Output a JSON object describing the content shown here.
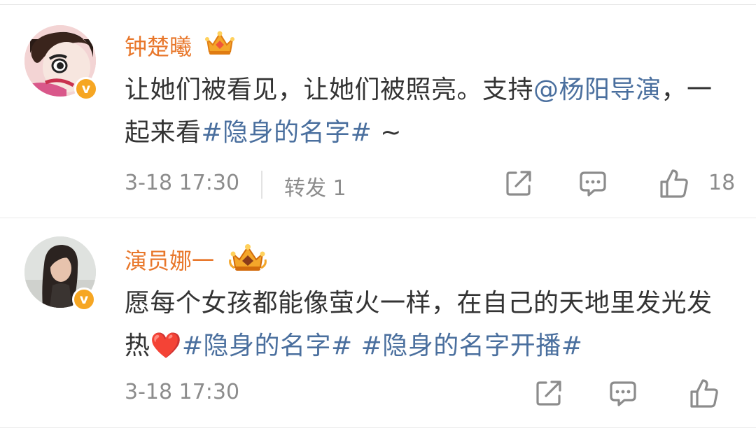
{
  "comments": [
    {
      "author": "钟楚曦",
      "author_color": "#e8772b",
      "verified_icon": "verified-v-badge-icon",
      "rank_icon": "crown-icon",
      "text_parts": [
        "让她们被看见，让她们被照亮。支持",
        "@杨阳导演",
        "，一起来看",
        "#隐身的名字#",
        " ~"
      ],
      "time": "3-18 17:30",
      "repost_label": "转发",
      "repost_count": "1",
      "like_count": "18"
    },
    {
      "author": "演员娜一",
      "author_color": "#e8772b",
      "verified_icon": "verified-v-badge-icon",
      "rank_icon": "crown-icon",
      "text_parts": [
        "愿每个女孩都能像萤火一样，在自己的天地里发光发热",
        "#隐身的名字#",
        " ",
        "#隐身的名字开播#"
      ],
      "emoji": "❤️",
      "time": "3-18 17:30"
    }
  ],
  "colors": {
    "link": "#4a6f9e",
    "text": "#333333",
    "meta": "#8c8c8c",
    "name": "#e8772b"
  }
}
